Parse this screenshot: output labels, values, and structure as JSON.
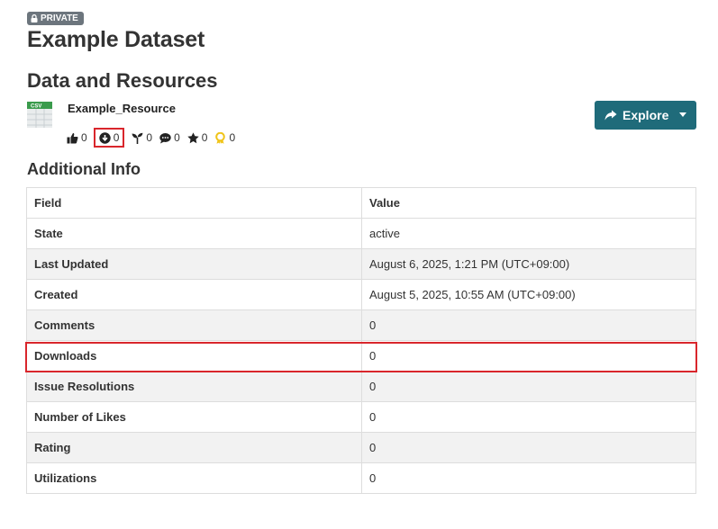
{
  "badge": {
    "label": "PRIVATE",
    "icon": "lock-icon"
  },
  "dataset": {
    "title": "Example Dataset"
  },
  "resources_section": {
    "heading": "Data and Resources"
  },
  "resource": {
    "format": "CSV",
    "name": "Example_Resource",
    "stats": {
      "likes": "0",
      "downloads": "0",
      "utilizations": "0",
      "comments": "0",
      "rating": "0",
      "issue_resolutions": "0"
    },
    "explore_label": "Explore"
  },
  "additional_info": {
    "heading": "Additional Info",
    "columns": {
      "field": "Field",
      "value": "Value"
    },
    "rows": [
      {
        "field": "State",
        "value": "active"
      },
      {
        "field": "Last Updated",
        "value": "August 6, 2025, 1:21 PM (UTC+09:00)"
      },
      {
        "field": "Created",
        "value": "August 5, 2025, 10:55 AM (UTC+09:00)"
      },
      {
        "field": "Comments",
        "value": "0"
      },
      {
        "field": "Downloads",
        "value": "0"
      },
      {
        "field": "Issue Resolutions",
        "value": "0"
      },
      {
        "field": "Number of Likes",
        "value": "0"
      },
      {
        "field": "Rating",
        "value": "0"
      },
      {
        "field": "Utilizations",
        "value": "0"
      }
    ]
  },
  "colors": {
    "accent": "#1f6b7a",
    "highlight": "#d9262c",
    "badge_bg": "#6c757d",
    "award": "#f0c419"
  }
}
